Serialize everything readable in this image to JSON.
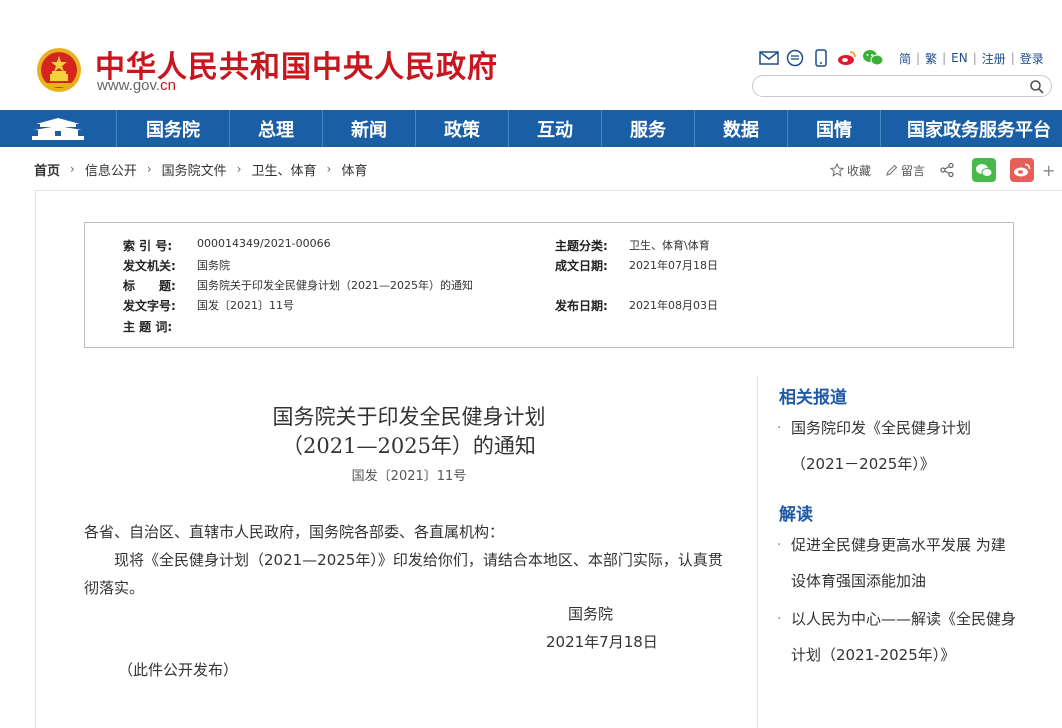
{
  "header": {
    "site_title": "中华人民共和国中央人民政府",
    "site_url_prefix": "www.gov.",
    "site_url_suffix": "cn",
    "brand_color": "#c8161e",
    "tools": [
      "email-icon",
      "chat-icon",
      "mobile-icon",
      "weibo-icon",
      "wechat-icon"
    ],
    "lang_links": [
      "简",
      "繁",
      "EN",
      "注册",
      "登录"
    ],
    "search_placeholder": ""
  },
  "nav": {
    "color": "#1a5ea6",
    "items": [
      "国务院",
      "总理",
      "新闻",
      "政策",
      "互动",
      "服务",
      "数据",
      "国情",
      "国家政务服务平台"
    ]
  },
  "breadcrumb": {
    "items": [
      "首页",
      "信息公开",
      "国务院文件",
      "卫生、体育",
      "体育"
    ]
  },
  "share_tools": {
    "favorite": "收藏",
    "comment": "留言"
  },
  "meta": {
    "index_label": "索 引 号:",
    "index_value": "000014349/2021-00066",
    "topic_label": "主题分类:",
    "topic_value": "卫生、体育\\体育",
    "issuer_label": "发文机关:",
    "issuer_value": "国务院",
    "written_label": "成文日期:",
    "written_value": "2021年07月18日",
    "title_label": "标　　题:",
    "title_value": "国务院关于印发全民健身计划（2021—2025年）的通知",
    "docno_label": "发文字号:",
    "docno_value": "国发〔2021〕11号",
    "published_label": "发布日期:",
    "published_value": "2021年08月03日",
    "keywords_label": "主 题 词:",
    "keywords_value": ""
  },
  "article": {
    "title_line1": "国务院关于印发全民健身计划",
    "title_line2": "（2021—2025年）的通知",
    "doc_number": "国发〔2021〕11号",
    "salutation": "各省、自治区、直辖市人民政府，国务院各部委、各直属机构：",
    "body": "现将《全民健身计划（2021—2025年）》印发给你们，请结合本地区、本部门实际，认真贯彻落实。",
    "signer": "国务院",
    "date": "2021年7月18日",
    "public_note": "（此件公开发布）"
  },
  "sidebar": {
    "related_heading": "相关报道",
    "related_items": [
      "国务院印发《全民健身计划（2021－2025年）》"
    ],
    "analysis_heading": "解读",
    "analysis_items": [
      "促进全民健身更高水平发展 为建设体育强国添能加油",
      "以人民为中心——解读《全民健身计划（2021-2025年）》"
    ],
    "heading_color": "#1f5aa6"
  }
}
